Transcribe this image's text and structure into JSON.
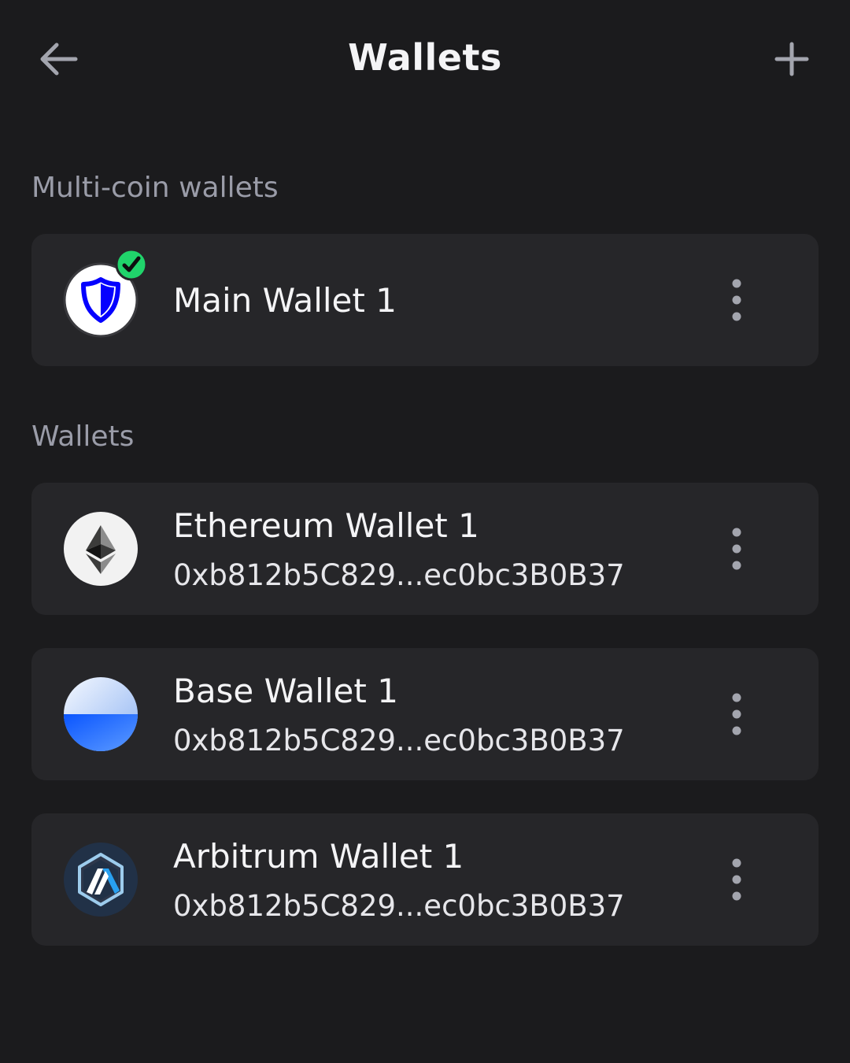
{
  "header": {
    "title": "Wallets",
    "back_icon": "arrow-left-icon",
    "add_icon": "plus-icon"
  },
  "sections": {
    "multi_coin": {
      "label": "Multi-coin wallets",
      "wallets": [
        {
          "name": "Main Wallet 1",
          "icon": "trust-shield-icon",
          "selected": true
        }
      ]
    },
    "single": {
      "label": "Wallets",
      "wallets": [
        {
          "name": "Ethereum Wallet 1",
          "address": "0xb812b5C829...ec0bc3B0B37",
          "icon": "ethereum-icon"
        },
        {
          "name": "Base Wallet 1",
          "address": "0xb812b5C829...ec0bc3B0B37",
          "icon": "base-icon"
        },
        {
          "name": "Arbitrum Wallet 1",
          "address": "0xb812b5C829...ec0bc3B0B37",
          "icon": "arbitrum-icon"
        }
      ]
    }
  },
  "colors": {
    "background": "#1b1b1d",
    "card": "#262629",
    "section_label": "#9a9ca8",
    "selected_badge": "#20d46b",
    "trust_blue": "#0500ff"
  }
}
